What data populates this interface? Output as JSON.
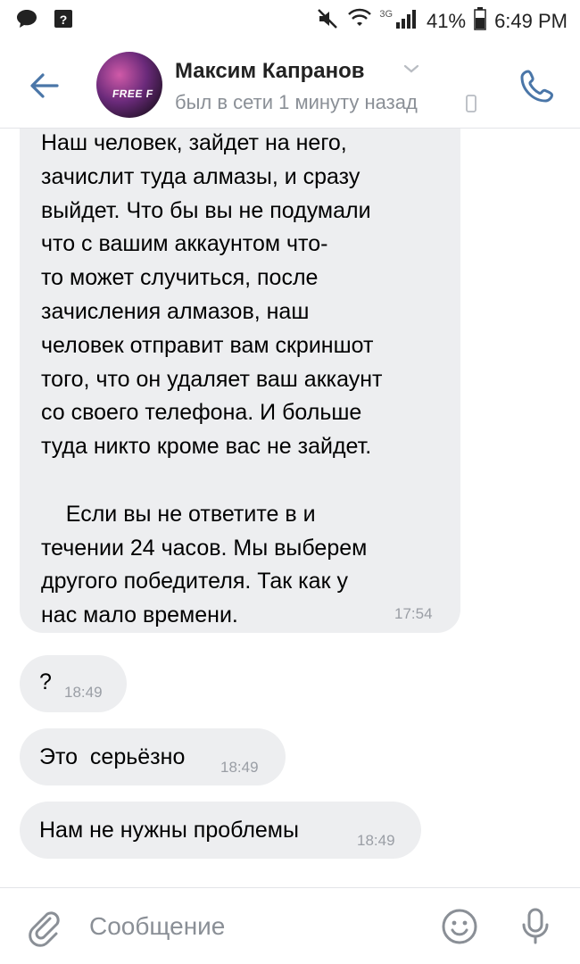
{
  "status_bar": {
    "icons_left": [
      "chat-bubble-icon",
      "notification-box-icon"
    ],
    "icons_right": [
      "mute-icon",
      "wifi-icon",
      "signal-icon",
      "battery-icon"
    ],
    "network": "3G",
    "battery": "41%",
    "time": "6:49 PM"
  },
  "header": {
    "name": "Максим Капранов",
    "last_seen": "был в сети 1 минуту назад",
    "avatar_text": "FREE F"
  },
  "messages": [
    {
      "text": "Наш человек, зайдет на него,\nзачислит туда алмазы, и сразу\nвыйдет. Что бы вы не подумали\nчто с вашим аккаунтом что-\nто может случиться, после\nзачисления алмазов, наш\nчеловек отправит вам скриншот\nтого, что он удаляет ваш аккаунт\nсо своего телефона. И больше\nтуда никто кроме вас не зайдет.\n\n    Если вы не ответите в и\nтечении 24 часов. Мы выберем\nдругого победителя. Так как у\nнас мало времени.",
      "time": "17:54"
    },
    {
      "text": "?",
      "time": "18:49"
    },
    {
      "text": "Это  серьёзно",
      "time": "18:49"
    },
    {
      "text": "Нам не нужны проблемы",
      "time": "18:49"
    }
  ],
  "composer": {
    "placeholder": "Сообщение"
  },
  "colors": {
    "accent": "#4a76a8",
    "bubble_bg": "#edeef0",
    "secondary_text": "#8a8f96"
  }
}
